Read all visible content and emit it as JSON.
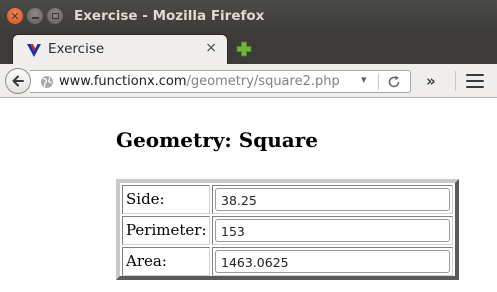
{
  "window": {
    "title": "Exercise - Mozilla Firefox"
  },
  "tabs": [
    {
      "label": "Exercise",
      "close_glyph": "×"
    }
  ],
  "navbar": {
    "url_host": "www.functionx.com",
    "url_path": "/geometry/square2.php",
    "dropdown_glyph": "▾",
    "overflow_glyph": "»"
  },
  "page": {
    "title": "Geometry: Square",
    "rows": [
      {
        "label": "Side:",
        "value": "38.25"
      },
      {
        "label": "Perimeter:",
        "value": "153"
      },
      {
        "label": "Area:",
        "value": "1463.0625"
      }
    ]
  },
  "colors": {
    "titlebar": "#3c3b37",
    "close_button": "#dd4814",
    "tab_bg": "#efeeec",
    "new_tab_plus": "#6fb43c"
  },
  "icons": {
    "favicon": "functionx-v-icon",
    "new_tab": "plus-icon",
    "site_identity": "globe-icon",
    "reload": "reload-icon",
    "menu": "hamburger-menu-icon"
  }
}
